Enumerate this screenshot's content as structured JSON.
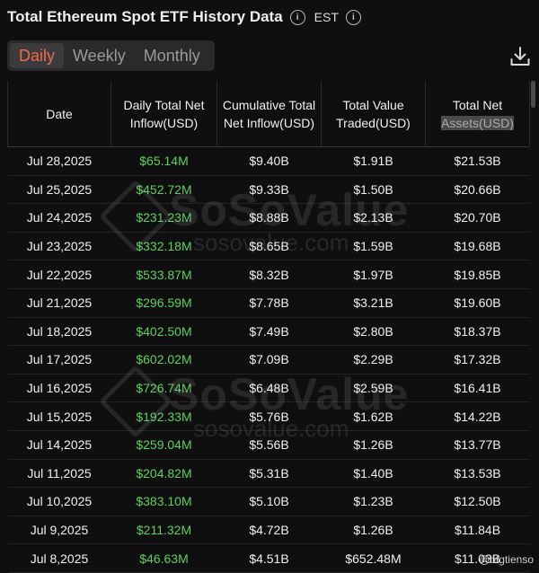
{
  "header": {
    "title": "Total Ethereum Spot ETF History Data",
    "timezone": "EST"
  },
  "tabs": [
    "Daily",
    "Weekly",
    "Monthly"
  ],
  "active_tab": "Daily",
  "table": {
    "columns": [
      "Date",
      "Daily Total Net Inflow(USD)",
      "Cumulative Total Net Inflow(USD)",
      "Total Value Traded(USD)",
      "Total Net Assets(USD)"
    ],
    "rows": [
      [
        "Jul 28,2025",
        "$65.14M",
        "$9.40B",
        "$1.91B",
        "$21.53B"
      ],
      [
        "Jul 25,2025",
        "$452.72M",
        "$9.33B",
        "$1.50B",
        "$20.66B"
      ],
      [
        "Jul 24,2025",
        "$231.23M",
        "$8.88B",
        "$2.13B",
        "$20.70B"
      ],
      [
        "Jul 23,2025",
        "$332.18M",
        "$8.65B",
        "$1.59B",
        "$19.68B"
      ],
      [
        "Jul 22,2025",
        "$533.87M",
        "$8.32B",
        "$1.97B",
        "$19.85B"
      ],
      [
        "Jul 21,2025",
        "$296.59M",
        "$7.78B",
        "$3.21B",
        "$19.60B"
      ],
      [
        "Jul 18,2025",
        "$402.50M",
        "$7.49B",
        "$2.80B",
        "$18.37B"
      ],
      [
        "Jul 17,2025",
        "$602.02M",
        "$7.09B",
        "$2.29B",
        "$17.32B"
      ],
      [
        "Jul 16,2025",
        "$726.74M",
        "$6.48B",
        "$2.59B",
        "$16.41B"
      ],
      [
        "Jul 15,2025",
        "$192.33M",
        "$5.76B",
        "$1.62B",
        "$14.22B"
      ],
      [
        "Jul 14,2025",
        "$259.04M",
        "$5.56B",
        "$1.26B",
        "$13.77B"
      ],
      [
        "Jul 11,2025",
        "$204.82M",
        "$5.31B",
        "$1.40B",
        "$13.53B"
      ],
      [
        "Jul 10,2025",
        "$383.10M",
        "$5.10B",
        "$1.23B",
        "$12.50B"
      ],
      [
        "Jul 9,2025",
        "$211.32M",
        "$4.72B",
        "$1.26B",
        "$11.84B"
      ],
      [
        "Jul 8,2025",
        "$46.63M",
        "$4.51B",
        "$652.48M",
        "$11.03B"
      ]
    ]
  },
  "watermark": {
    "brand": "SoSoValue",
    "url": "sosovalue.com"
  },
  "credit": "@btgtienso",
  "colors": {
    "accent": "#ef6a4a",
    "positive": "#5cd25c",
    "background": "#0f0f10"
  },
  "icons": {
    "info": "info-icon",
    "download": "download-icon"
  }
}
